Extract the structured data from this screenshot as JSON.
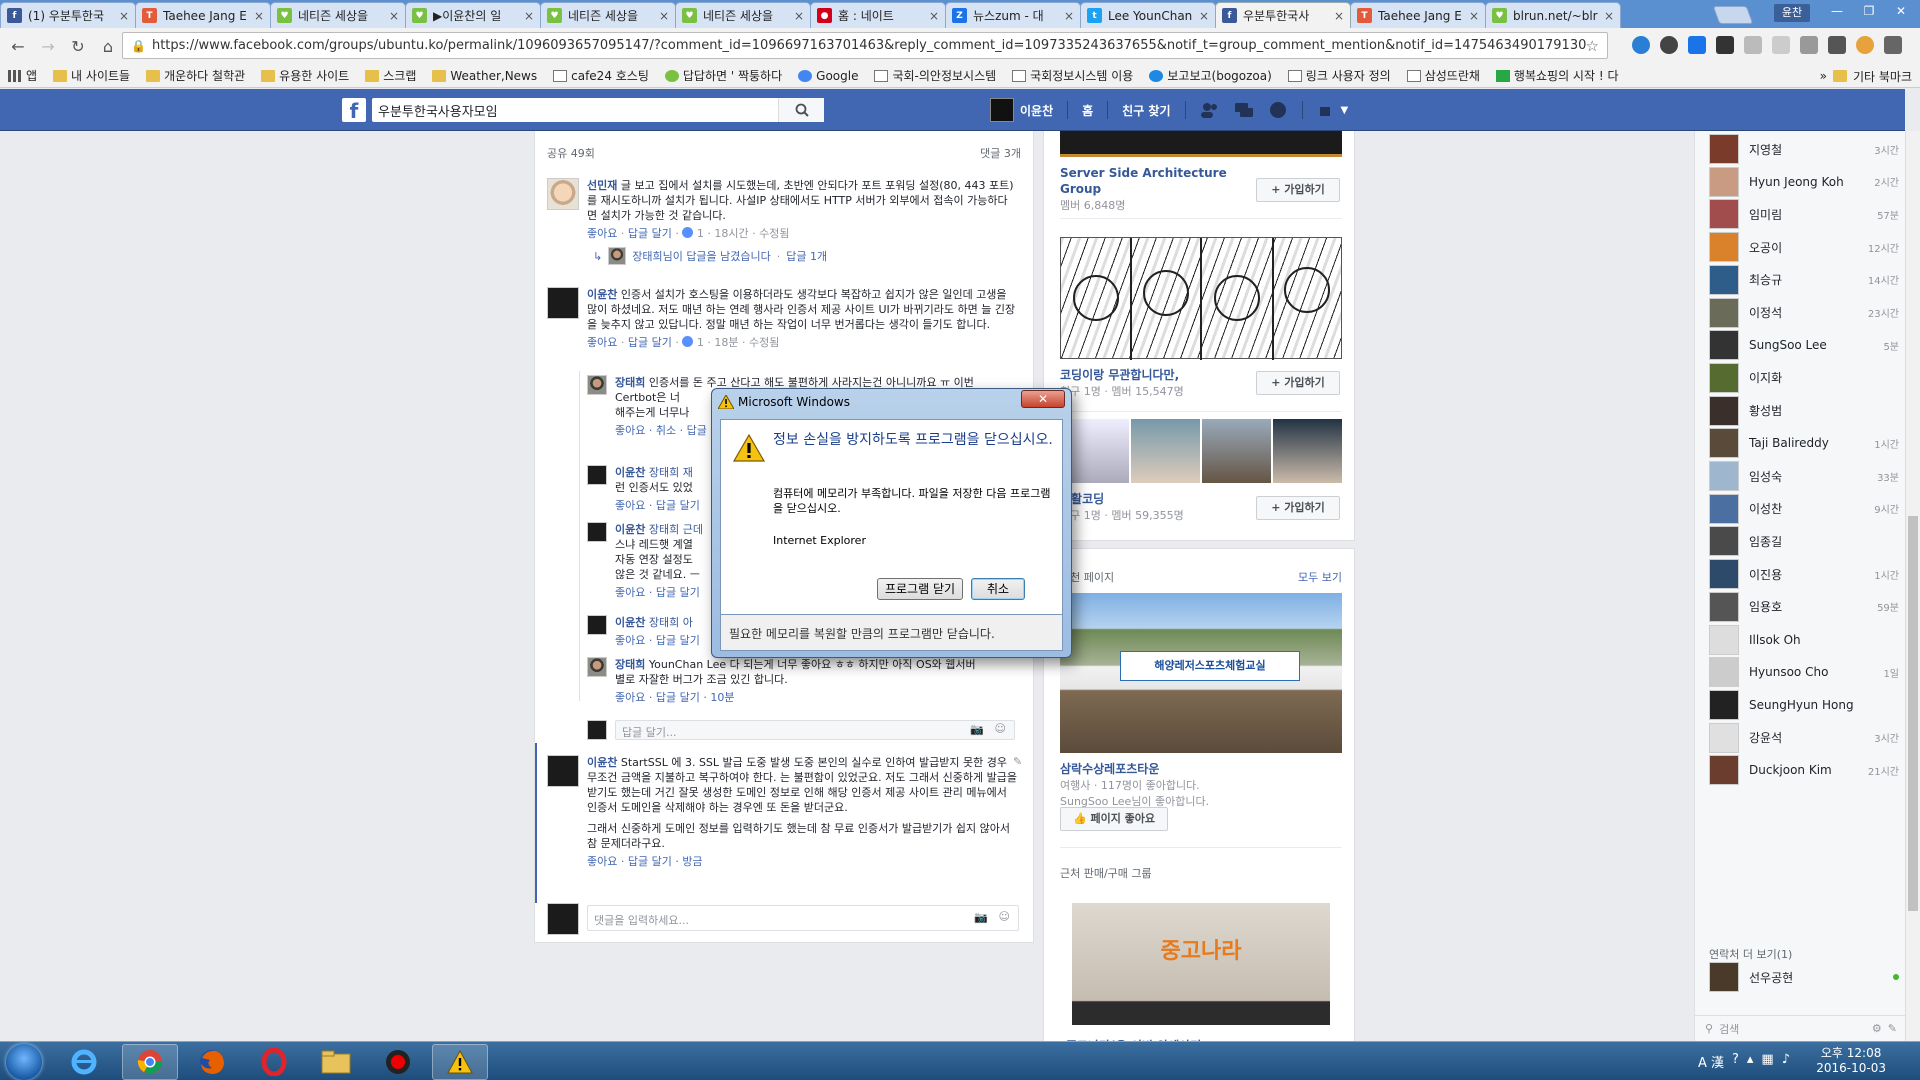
{
  "browser": {
    "tabs": [
      {
        "title": "(1) 우분투한국",
        "fav": "facebook-icon",
        "color": "#3b5998",
        "glyph": "f"
      },
      {
        "title": "Taehee Jang E",
        "fav": "red-circle-icon",
        "color": "#e25b3b",
        "glyph": "T"
      },
      {
        "title": "네티즌 세상을",
        "fav": "heart-icon",
        "color": "#7ac143",
        "glyph": "♥"
      },
      {
        "title": "▶이윤찬의 일",
        "fav": "heart-icon",
        "color": "#7ac143",
        "glyph": "♥"
      },
      {
        "title": "네티즌 세상을",
        "fav": "heart-icon",
        "color": "#7ac143",
        "glyph": "♥"
      },
      {
        "title": "네티즌 세상을",
        "fav": "heart-icon",
        "color": "#7ac143",
        "glyph": "♥"
      },
      {
        "title": "홈 : 네이트",
        "fav": "red-shield-icon",
        "color": "#d0021b",
        "glyph": "●"
      },
      {
        "title": "뉴스zum - 대",
        "fav": "zum-icon",
        "color": "#1a73e8",
        "glyph": "Z"
      },
      {
        "title": "Lee YounChan",
        "fav": "twitter-icon",
        "color": "#1da1f2",
        "glyph": "t"
      },
      {
        "title": "우분투한국사",
        "fav": "facebook-icon",
        "color": "#3b5998",
        "glyph": "f"
      },
      {
        "title": "Taehee Jang E",
        "fav": "red-circle-icon",
        "color": "#e25b3b",
        "glyph": "T"
      },
      {
        "title": "blrun.net/~blr",
        "fav": "heart-icon",
        "color": "#7ac143",
        "glyph": "♥"
      }
    ],
    "active_tab": 9,
    "profile_name": "윤찬",
    "url": "https://www.facebook.com/groups/ubuntu.ko/permalink/1096093657095147/?comment_id=1096697163701463&reply_comment_id=1097335243637655&notif_t=group_comment_mention&notif_id=1475463490179130",
    "bookmarks": [
      {
        "label": "앱",
        "kind": "apps"
      },
      {
        "label": "내 사이트들",
        "kind": "folder"
      },
      {
        "label": "개운하다 철학관",
        "kind": "folder"
      },
      {
        "label": "유용한 사이트",
        "kind": "folder"
      },
      {
        "label": "스크랩",
        "kind": "folder"
      },
      {
        "label": "Weather,News",
        "kind": "folder"
      },
      {
        "label": "cafe24 호스팅",
        "kind": "page"
      },
      {
        "label": "답답하면 ' 짝퉁하다",
        "kind": "heart"
      },
      {
        "label": "Google",
        "kind": "google"
      },
      {
        "label": "국회-의안정보시스템",
        "kind": "page"
      },
      {
        "label": "국회정보시스템 이용",
        "kind": "page"
      },
      {
        "label": "보고보고(bogozoa)",
        "kind": "blue"
      },
      {
        "label": "링크 사용자 정의",
        "kind": "page"
      },
      {
        "label": "삼성뜨란채",
        "kind": "page"
      },
      {
        "label": "행복쇼핑의 시작 ! 다",
        "kind": "green"
      }
    ],
    "bookmarks_more": "»",
    "other_bookmarks": "기타 북마크"
  },
  "facebook": {
    "search_value": "우분투한국사용자모임",
    "user_name": "이윤찬",
    "nav_home": "홈",
    "nav_find_friends": "친구 찾기"
  },
  "feed": {
    "share_count": "공유 49회",
    "comment_count": "댓글 3개",
    "comments": [
      {
        "author": "선민재",
        "text": "글 보고 집에서 설치를 시도했는데, 초반엔 안되다가 포트 포워딩 설정(80, 443 포트)를 재시도하니까 설치가 됩니다. 사설IP 상태에서도 HTTP 서버가 외부에서 접속이 가능하다면 설치가 가능한 것 같습니다.",
        "like": "좋아요",
        "reply": "답글 달기",
        "likes": "1",
        "time": "18시간",
        "edited": "수정됨"
      },
      {
        "author": "이윤찬",
        "text": "인증서 설치가 호스팅을 이용하더라도 생각보다 복잡하고 쉽지가 않은 일인데 고생을 많이 하셨네요. 저도 매년 하는 연례 행사라 인증서 제공 사이트 UI가 바뀌기라도 하면 늘 긴장을 늦추지 않고 있답니다. 정말 매년 하는 작업이 너무 번거롭다는 생각이 들기도 합니다.",
        "like": "좋아요",
        "reply": "답글 달기",
        "likes": "1",
        "time": "18분",
        "edited": "수정됨"
      }
    ],
    "reply_summary": "장태희님이 답글을 남겼습니다",
    "reply_count": "답글 1개",
    "replies": [
      {
        "author": "장태희",
        "text": "인증서를 돈 주고 산다고 해도 불편하게 사라지는건 아니니까요 ㅠ 이번 Certbot은 너",
        "text2": "해주는게 너무나",
        "actions": "좋아요 · 취소 · 답글"
      },
      {
        "author": "이윤찬",
        "text": "장태희 재",
        "text2": "런 인증서도 있었",
        "actions": "좋아요 · 답글 달기"
      },
      {
        "author": "이윤찬",
        "text": "장태희 근데",
        "text2": "스냐 레드햇 계열",
        "text3": "자동 연장 설정도",
        "text4": "않은 것 같네요. ㅡ",
        "actions": "좋아요 · 답글 달기"
      },
      {
        "author": "이윤찬",
        "text": "장태희 아",
        "actions": "좋아요 · 답글 달기"
      },
      {
        "author": "장태희",
        "text": "YounChan Lee 다 되는게 너무 좋아요 ㅎㅎ 하지만 아직 OS와 웹서버 별로 자잘한 버그가 조금 있긴 합니다.",
        "actions": "좋아요 · 답글 달기 · 10분"
      }
    ],
    "reply_placeholder": "답글 달기...",
    "third_comment": {
      "author": "이윤찬",
      "text": "StartSSL 에 3. SSL 발급 도중 발생 도중 본인의 실수로 인하여 발급받지 못한 경우 무조건 금액을 지불하고 복구하여야 한다. 는 불편함이 있었군요. 저도 그래서 신중하게 발급을 받기도 했는데 거긴 잘못 생성한 도메인 정보로 인해 해당 인증서 제공 사이트 관리 메뉴에서 인증서 도메인을 삭제해야 하는 경우엔 또 돈을 받더군요.",
      "text_b": "그래서 신중하게 도메인 정보를 입력하기도 했는데 참 무료 인증서가 발급받기가 쉽지 않아서 참 문제더라구요.",
      "actions": "좋아요 · 답글 달기 · 방금"
    },
    "comment_placeholder": "댓글을 입력하세요..."
  },
  "right": {
    "groups": [
      {
        "name": "Server Side Architecture Group",
        "meta": "멤버 6,848명",
        "join": "+ 가입하기"
      },
      {
        "name": "코딩이랑 무관합니다만,",
        "meta": "친구 1명 · 멤버 15,547명",
        "join": "+ 가입하기"
      },
      {
        "name": "생활코딩",
        "meta": "친구 1명 · 멤버 59,355명",
        "join": "+ 가입하기"
      }
    ],
    "pages_header": "추천 페이지",
    "pages_see_all": "모두 보기",
    "page_name": "삼락수상레포츠타운",
    "page_meta": "여행사 · 117명이 좋아합니다.",
    "page_friend": "SungSoo Lee님이 좋아합니다.",
    "page_like": "페이지 좋아요",
    "banner_text": "해양레저스포츠체험교실",
    "market_header": "근처 판매/구매 그룹",
    "market_name": "중고나라",
    "market_bottom": "중고나라(온 서비 안세사리"
  },
  "chat": {
    "friends": [
      {
        "name": "지영철",
        "time": "3시간"
      },
      {
        "name": "Hyun Jeong Koh",
        "time": "2시간"
      },
      {
        "name": "임미림",
        "time": "57분"
      },
      {
        "name": "오공이",
        "time": "12시간"
      },
      {
        "name": "최승규",
        "time": "14시간"
      },
      {
        "name": "이정석",
        "time": "23시간"
      },
      {
        "name": "SungSoo Lee",
        "time": "5분"
      },
      {
        "name": "이지화",
        "time": ""
      },
      {
        "name": "황성범",
        "time": ""
      },
      {
        "name": "Taji Balireddy",
        "time": "1시간"
      },
      {
        "name": "임성숙",
        "time": "33분"
      },
      {
        "name": "이성찬",
        "time": "9시간"
      },
      {
        "name": "임종길",
        "time": ""
      },
      {
        "name": "이진용",
        "time": "1시간"
      },
      {
        "name": "임용호",
        "time": "59분"
      },
      {
        "name": "Illsok Oh",
        "time": ""
      },
      {
        "name": "Hyunsoo Cho",
        "time": "1일"
      },
      {
        "name": "SeungHyun Hong",
        "time": ""
      },
      {
        "name": "강윤석",
        "time": "3시간"
      },
      {
        "name": "Duckjoon Kim",
        "time": "21시간"
      }
    ],
    "more_contacts": "연락처 더 보기(1)",
    "online_friend": "선우공현",
    "search_placeholder": "검색"
  },
  "dialog": {
    "title": "Microsoft Windows",
    "close": "✕",
    "main": "정보 손실을 방지하도록 프로그램을 닫으십시오.",
    "sub": "컴퓨터에 메모리가 부족합니다. 파일을 저장한 다음 프로그램을 닫으십시오.",
    "app": "Internet Explorer",
    "btn_close_program": "프로그램 닫기",
    "btn_cancel": "취소",
    "footer": "필요한 메모리를 복원할 만큼의 프로그램만 닫습니다."
  },
  "taskbar": {
    "time": "오후 12:08",
    "date": "2016-10-03",
    "ime": "A 漢"
  }
}
